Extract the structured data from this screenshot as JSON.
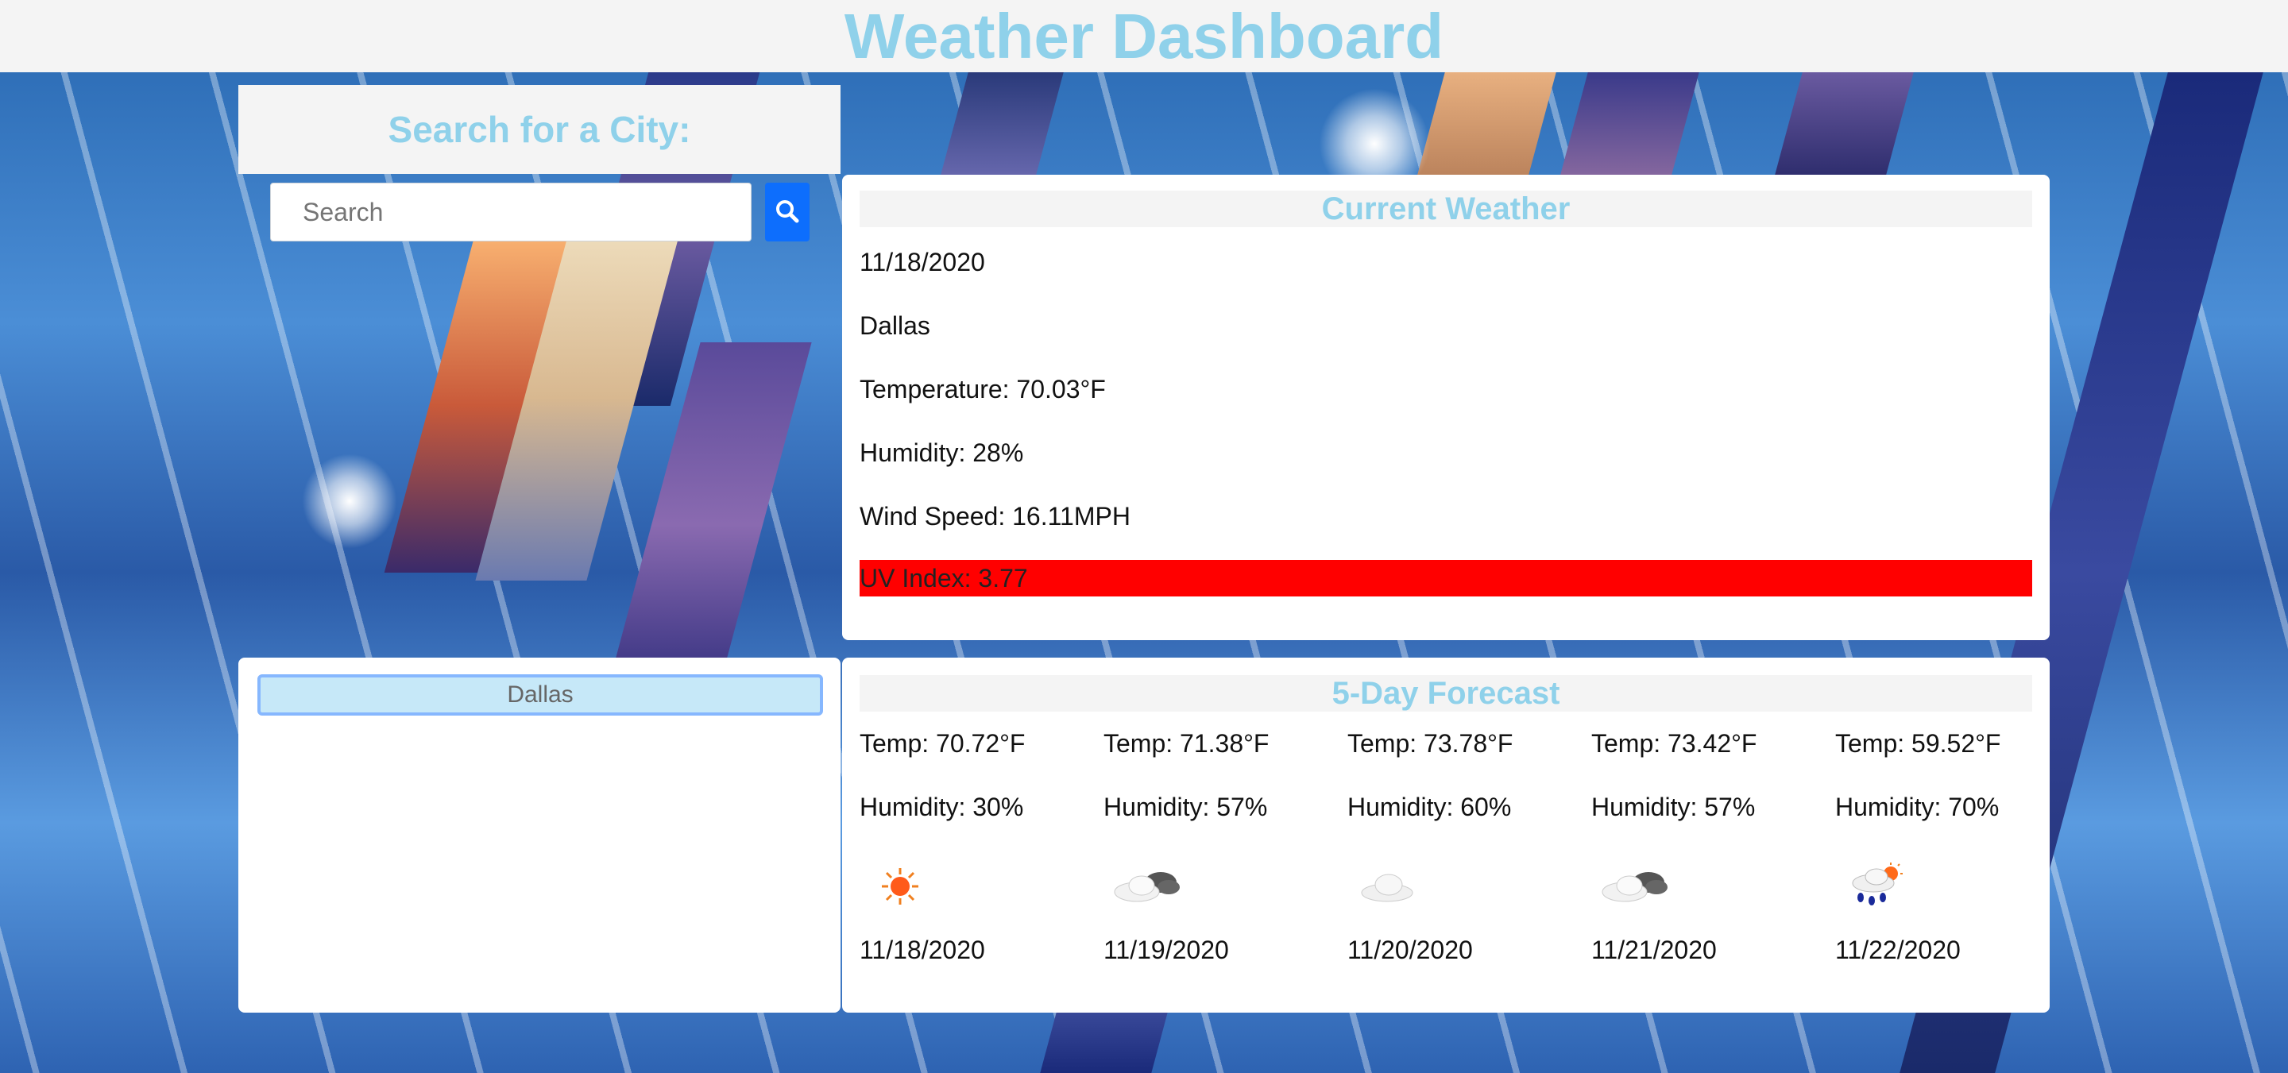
{
  "header": {
    "title": "Weather Dashboard"
  },
  "search": {
    "heading": "Search for a City:",
    "placeholder": "Search",
    "button_icon": "search-icon"
  },
  "history": {
    "cities": [
      "Dallas"
    ]
  },
  "current": {
    "title": "Current Weather",
    "date": "11/18/2020",
    "city": "Dallas",
    "temperature": "Temperature: 70.03°F",
    "humidity": "Humidity: 28%",
    "wind": "Wind Speed: 16.11MPH",
    "uv": "UV Index: 3.77",
    "uv_color": "#ff0000"
  },
  "forecast": {
    "title": "5-Day Forecast",
    "days": [
      {
        "temp": "Temp: 70.72°F",
        "humidity": "Humidity: 30%",
        "icon": "sun-icon",
        "date": "11/18/2020"
      },
      {
        "temp": "Temp: 71.38°F",
        "humidity": "Humidity: 57%",
        "icon": "cloud-icon",
        "date": "11/19/2020"
      },
      {
        "temp": "Temp: 73.78°F",
        "humidity": "Humidity: 60%",
        "icon": "light-cloud-icon",
        "date": "11/20/2020"
      },
      {
        "temp": "Temp: 73.42°F",
        "humidity": "Humidity: 57%",
        "icon": "cloud-icon",
        "date": "11/21/2020"
      },
      {
        "temp": "Temp: 59.52°F",
        "humidity": "Humidity: 70%",
        "icon": "rain-sun-icon",
        "date": "11/22/2020"
      }
    ]
  },
  "colors": {
    "accent": "#8fd1ea",
    "button": "#0d6efd"
  }
}
